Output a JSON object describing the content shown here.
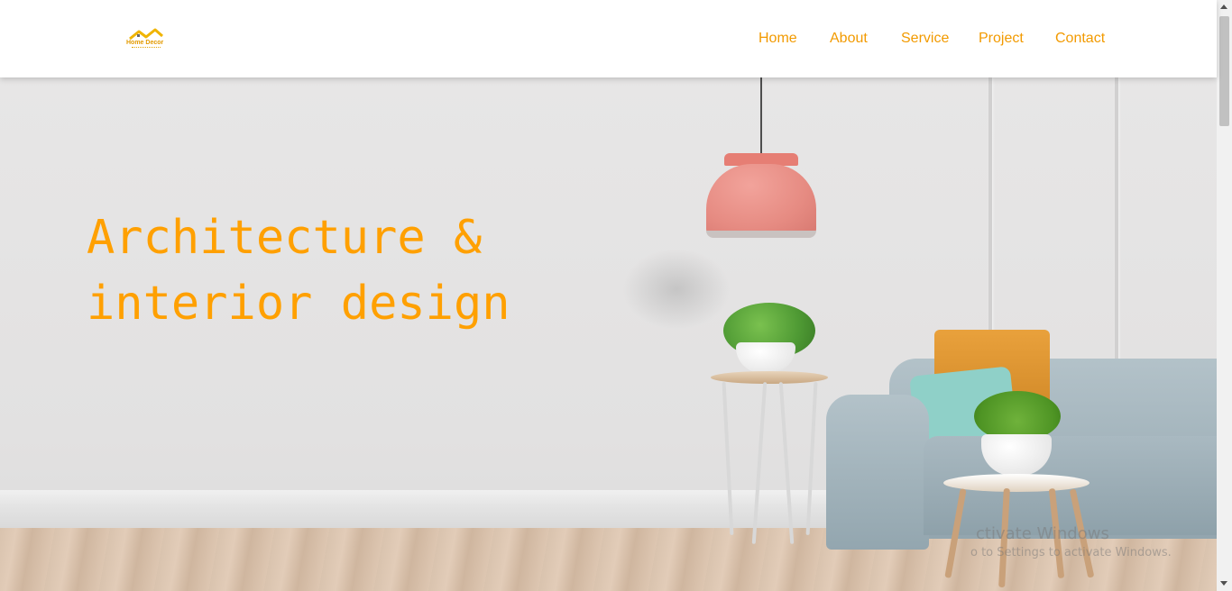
{
  "brand": {
    "logo_text": "Home Decor",
    "accent_color": "#ffa000"
  },
  "nav": {
    "items": [
      "Home",
      "About",
      "Service",
      "Project",
      "Contact"
    ]
  },
  "hero": {
    "title_line1": "Architecture &",
    "title_line2": "interior design"
  },
  "watermark": {
    "title": "ctivate Windows",
    "subtitle": "o to Settings to activate Windows."
  }
}
